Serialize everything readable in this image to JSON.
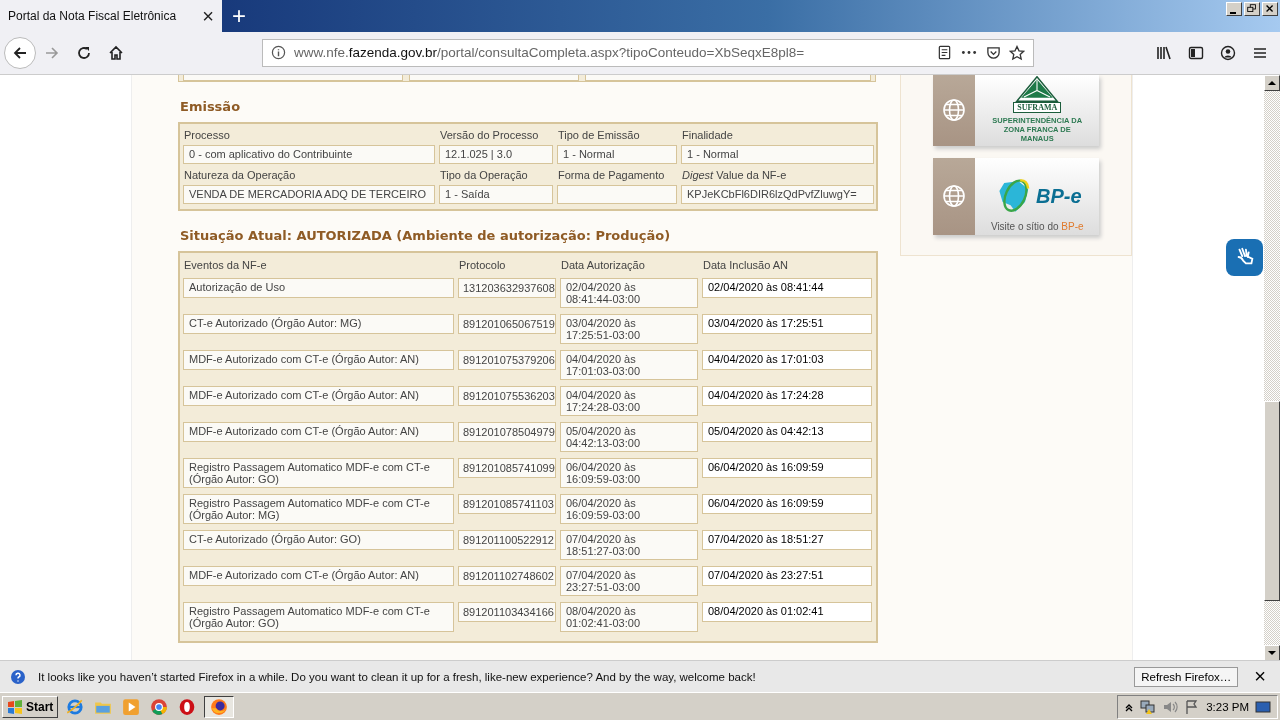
{
  "browser": {
    "tab": {
      "title": "Portal da Nota Fiscal Eletrônica",
      "close": "×"
    },
    "new_tab": "+",
    "url": "www.nfe.**fazenda.gov.br**/portal/consultaCompleta.aspx?tipoConteudo=XbSeqxE8pl8="
  },
  "emission": {
    "title": "Emissão",
    "fields": [
      {
        "label": "Processo",
        "value": "0 - com aplicativo do Contribuinte"
      },
      {
        "label": "Versão do Processo",
        "value": "12.1.025 | 3.0"
      },
      {
        "label": "Tipo de Emissão",
        "value": "1 - Normal"
      },
      {
        "label": "Finalidade",
        "value": "1 - Normal"
      },
      {
        "label": "Natureza da Operação",
        "value": "VENDA DE MERCADORIA ADQ DE TERCEIRO"
      },
      {
        "label": "Tipo da Operação",
        "value": "1 - Saída"
      },
      {
        "label": "Forma de Pagamento"
      },
      {
        "label": "*Digest* Value da NF-e",
        "value": "KPJeKCbFl6DIR6lzQdPvfZluwgY="
      }
    ]
  },
  "status": {
    "title": "Situação Atual: AUTORIZADA (Ambiente de autorização: Produção)",
    "columns": [
      "Eventos da NF-e",
      "Protocolo",
      "Data Autorização",
      "Data Inclusão AN"
    ],
    "rows": [
      {
        "event": "Autorização de Uso",
        "protocol": "131203632937608",
        "authorized": "02/04/2020 às 08:41:44-03:00",
        "included": "02/04/2020 às 08:41:44"
      },
      {
        "event": "CT-e Autorizado (Órgão Autor: MG)",
        "protocol": "891201065067519",
        "authorized": "03/04/2020 às 17:25:51-03:00",
        "included": "03/04/2020 às 17:25:51"
      },
      {
        "event": "MDF-e Autorizado com CT-e (Órgão Autor: AN)",
        "protocol": "891201075379206",
        "authorized": "04/04/2020 às 17:01:03-03:00",
        "included": "04/04/2020 às 17:01:03"
      },
      {
        "event": "MDF-e Autorizado com CT-e (Órgão Autor: AN)",
        "protocol": "891201075536203",
        "authorized": "04/04/2020 às 17:24:28-03:00",
        "included": "04/04/2020 às 17:24:28"
      },
      {
        "event": "MDF-e Autorizado com CT-e (Órgão Autor: AN)",
        "protocol": "891201078504979",
        "authorized": "05/04/2020 às 04:42:13-03:00",
        "included": "05/04/2020 às 04:42:13"
      },
      {
        "event": "Registro Passagem Automatico MDF-e com CT-e (Órgão Autor: GO)",
        "protocol": "891201085741099",
        "authorized": "06/04/2020 às 16:09:59-03:00",
        "included": "06/04/2020 às 16:09:59"
      },
      {
        "event": "Registro Passagem Automatico MDF-e com CT-e (Órgão Autor: MG)",
        "protocol": "891201085741103",
        "authorized": "06/04/2020 às 16:09:59-03:00",
        "included": "06/04/2020 às 16:09:59"
      },
      {
        "event": "CT-e Autorizado (Órgão Autor: GO)",
        "protocol": "891201100522912",
        "authorized": "07/04/2020 às 18:51:27-03:00",
        "included": "07/04/2020 às 18:51:27"
      },
      {
        "event": "MDF-e Autorizado com CT-e (Órgão Autor: AN)",
        "protocol": "891201102748602",
        "authorized": "07/04/2020 às 23:27:51-03:00",
        "included": "07/04/2020 às 23:27:51"
      },
      {
        "event": "Registro Passagem Automatico MDF-e com CT-e (Órgão Autor: GO)",
        "protocol": "891201103434166",
        "authorized": "08/04/2020 às 01:02:41-03:00",
        "included": "08/04/2020 às 01:02:41"
      }
    ]
  },
  "sidebar": {
    "banners": [
      {
        "kind": "suframa",
        "logo": "SUFRAMA",
        "caption": "SUPERINTENDÊNCIA DA ZONA FRANCA DE MANAUS"
      },
      {
        "kind": "bpe",
        "logo": "BP-e",
        "caption": "Visite o sítio do **BP-e**"
      }
    ]
  },
  "notification": {
    "text": "It looks like you haven’t started Firefox in a while. Do you want to clean it up for a fresh, like-new experience? And by the way, welcome back!",
    "button": "Refresh Firefox…",
    "close": "×"
  },
  "taskbar": {
    "start": "Start",
    "time": "3:23 PM"
  }
}
